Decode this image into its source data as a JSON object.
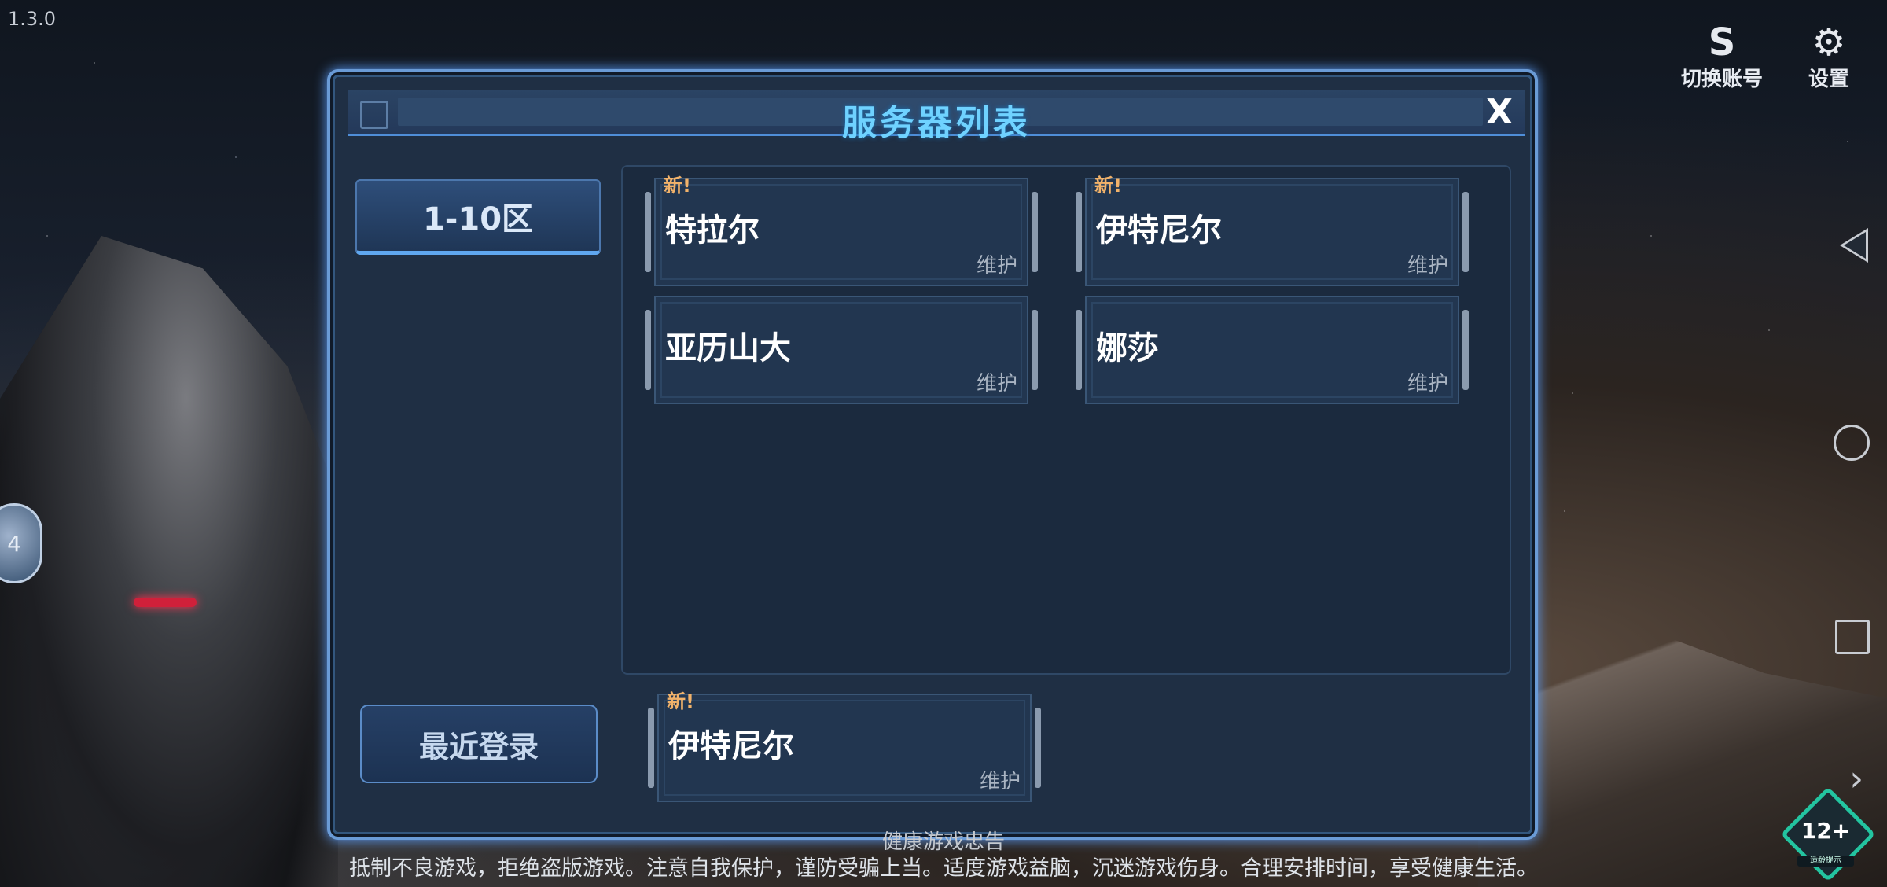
{
  "version": "1.3.0",
  "top_buttons": {
    "switch_account": {
      "label": "切换账号",
      "icon": "s-logo-icon"
    },
    "settings": {
      "label": "设置",
      "icon": "gear-icon"
    }
  },
  "side_badge": "4",
  "dialog": {
    "title": "服务器列表",
    "close_label": "X",
    "zone_tab": "1-10区",
    "recent_login_label": "最近登录",
    "servers": [
      {
        "new_tag": "新!",
        "name": "特拉尔",
        "status": "维护"
      },
      {
        "new_tag": "新!",
        "name": "伊特尼尔",
        "status": "维护"
      },
      {
        "new_tag": "",
        "name": "亚历山大",
        "status": "维护"
      },
      {
        "new_tag": "",
        "name": "娜莎",
        "status": "维护"
      }
    ],
    "recent_server": {
      "new_tag": "新!",
      "name": "伊特尼尔",
      "status": "维护"
    }
  },
  "footer": {
    "title": "健康游戏忠告",
    "text": "抵制不良游戏，拒绝盗版游戏。注意自我保护，谨防受骗上当。适度游戏益脑，沉迷游戏伤身。合理安排时间，享受健康生活。"
  },
  "age_rating": {
    "label": "12+",
    "sub": "适龄提示"
  },
  "colors": {
    "accent": "#6fd2ff",
    "dialog_bg": "#1f2f44",
    "border": "#6a9bd6",
    "new_tag": "#f1b26a"
  }
}
